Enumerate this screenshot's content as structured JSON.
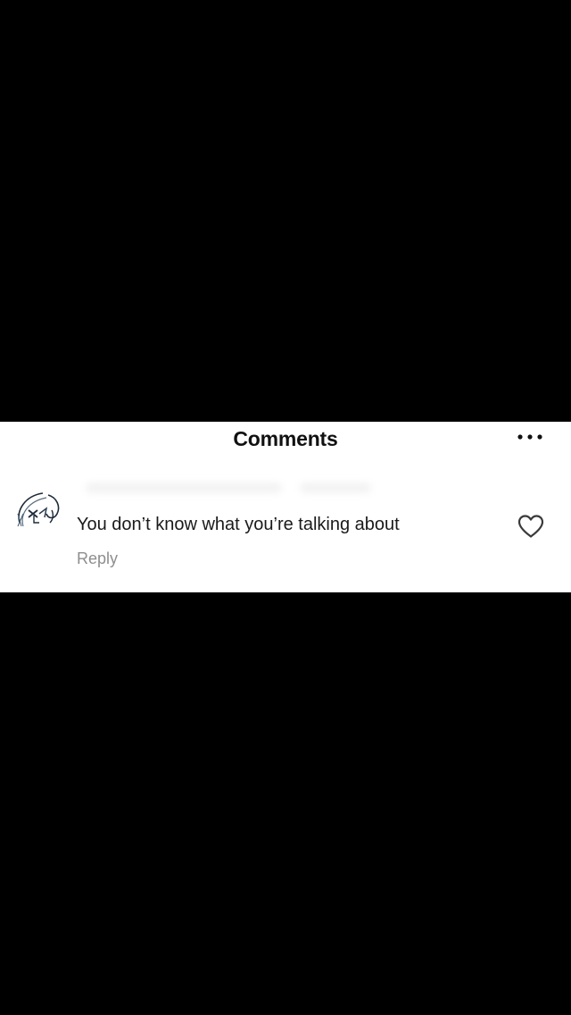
{
  "header": {
    "title": "Comments",
    "more_icon": "more-horizontal-icon"
  },
  "comment": {
    "avatar_icon": "drawn-avatar-icon",
    "text": "You don’t know what you’re talking about",
    "reply_label": "Reply",
    "like_icon": "heart-outline-icon"
  },
  "colors": {
    "background": "#000000",
    "card": "#ffffff",
    "text": "#1a1a1a",
    "muted": "#8e8e8e"
  }
}
